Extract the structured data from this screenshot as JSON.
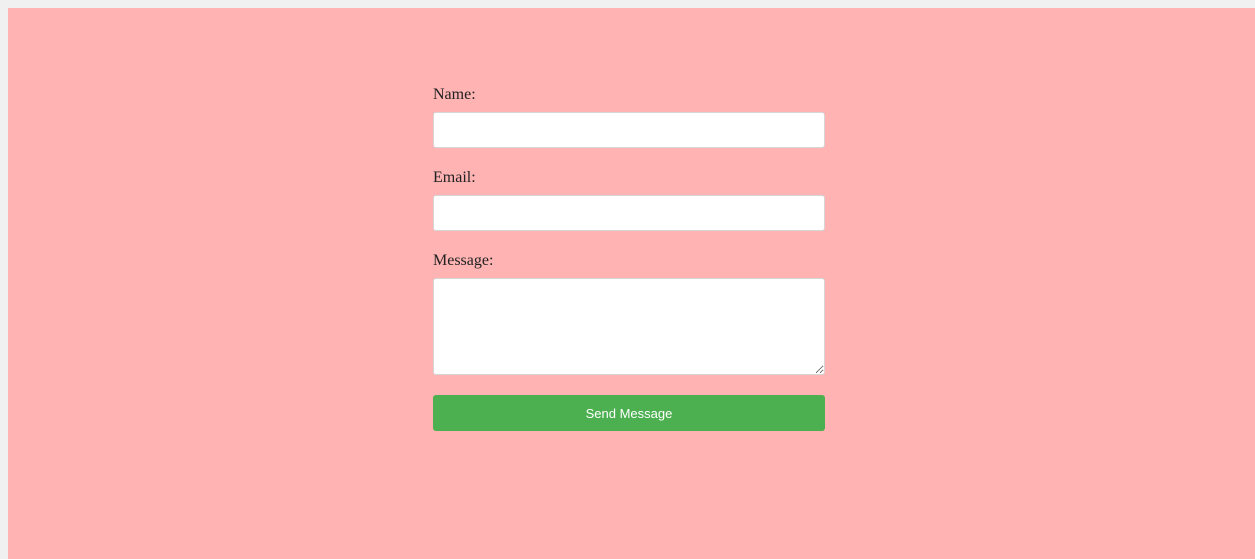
{
  "form": {
    "name_label": "Name:",
    "name_value": "",
    "email_label": "Email:",
    "email_value": "",
    "message_label": "Message:",
    "message_value": "",
    "submit_label": "Send Message"
  },
  "colors": {
    "page_background": "#ffb3b3",
    "submit_background": "#4caf50",
    "submit_text": "#ffffff",
    "input_background": "#ffffff"
  }
}
